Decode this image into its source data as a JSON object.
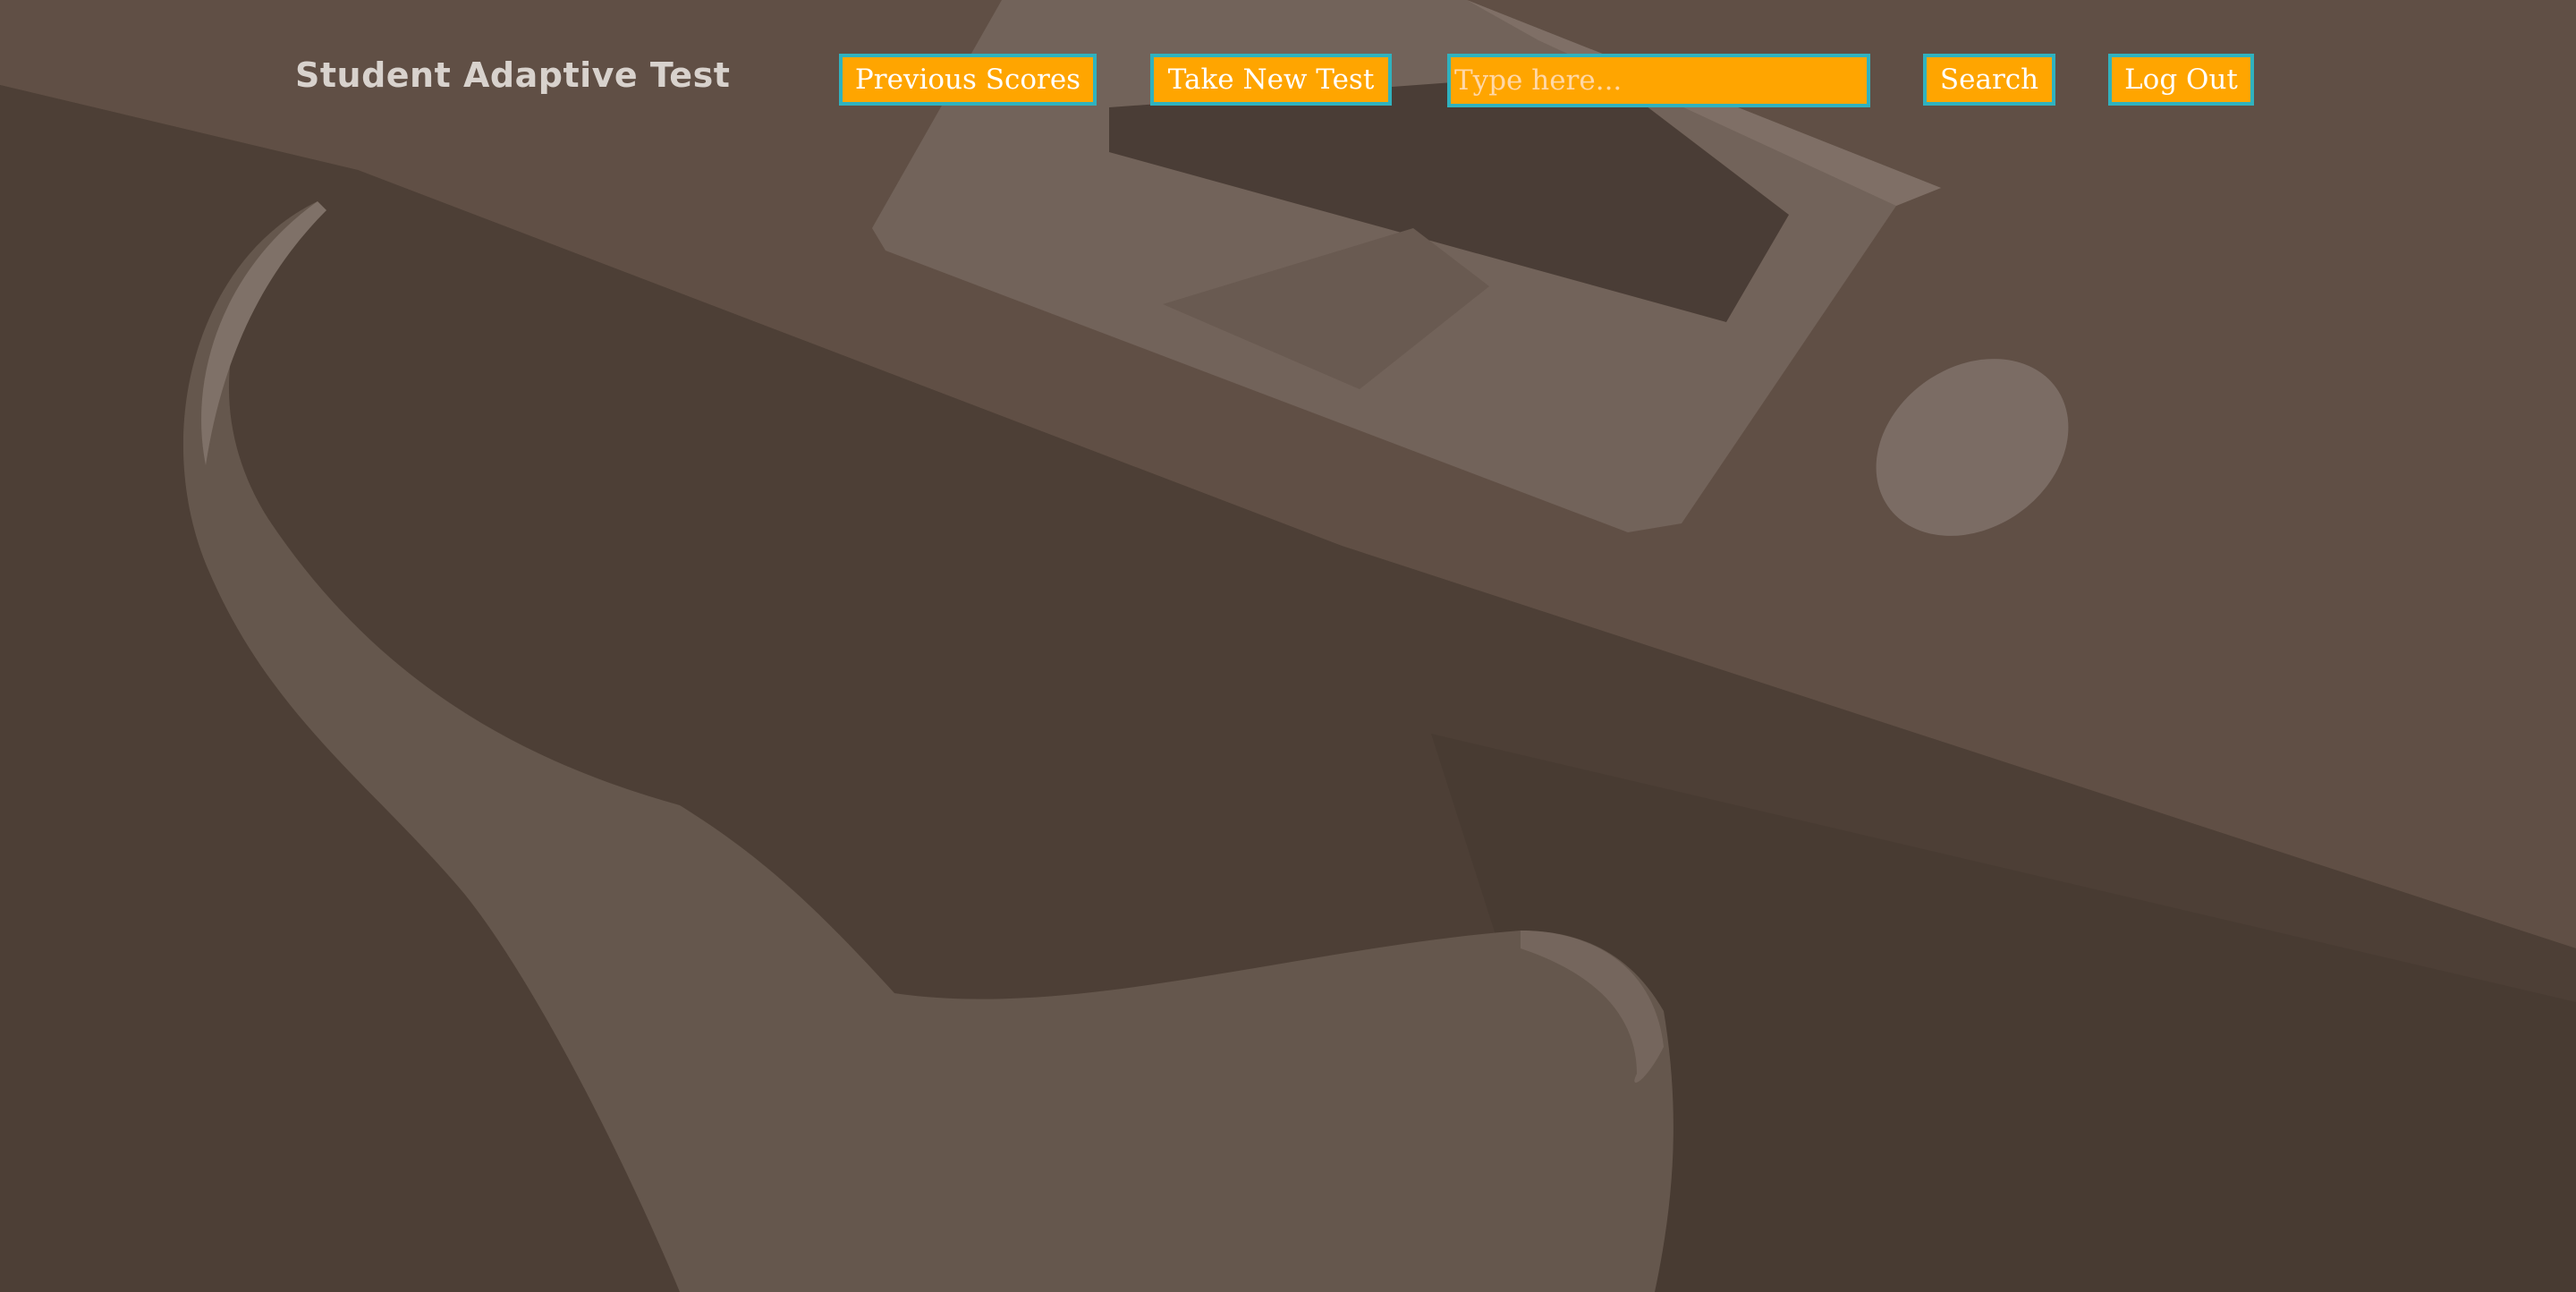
{
  "app": {
    "brand": "Student Adaptive Test"
  },
  "nav": {
    "previous_scores": "Previous Scores",
    "take_new_test": "Take New Test",
    "search_placeholder": "Type here...",
    "search_label": "Search",
    "logout": "Log Out"
  },
  "background": {
    "depiction": [
      "laptop",
      "mouse",
      "desk",
      "chair"
    ]
  },
  "colors": {
    "button_fill": "#ffa500",
    "button_border": "#2fb2bf",
    "button_text": "#ffffff",
    "brand_text": "#d8d2cd",
    "page_background": "#4f4239"
  }
}
